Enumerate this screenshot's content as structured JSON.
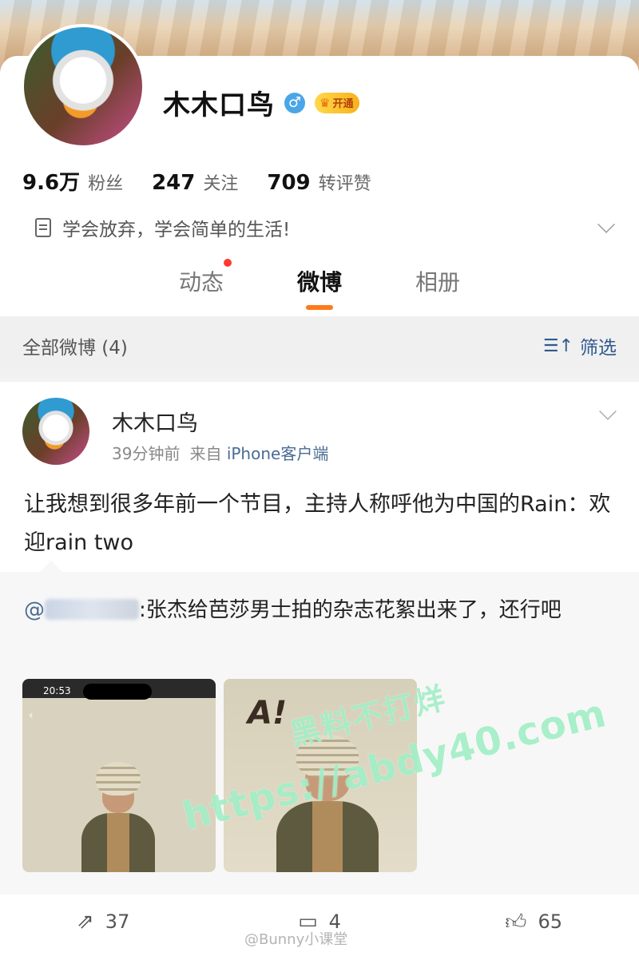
{
  "profile": {
    "name": "木木口鸟",
    "gender_icon": "♂",
    "vip_label": "开通",
    "stats": [
      {
        "value": "9.6万",
        "label": "粉丝"
      },
      {
        "value": "247",
        "label": "关注"
      },
      {
        "value": "709",
        "label": "转评赞"
      }
    ],
    "bio": "学会放弃，学会简单的生活!"
  },
  "tabs": [
    {
      "label": "动态",
      "has_dot": true
    },
    {
      "label": "微博",
      "active": true
    },
    {
      "label": "相册"
    }
  ],
  "filter_bar": {
    "count_label": "全部微博 (4)",
    "filter_label": "筛选"
  },
  "post": {
    "author": "木木口鸟",
    "time": "39分钟前",
    "source_prefix": "来自",
    "source": "iPhone客户端",
    "text": "让我想到很多年前一个节目，主持人称呼他为中国的Rain：欢迎rain two",
    "repost": {
      "mention_prefix": "@",
      "text": ":张杰给芭莎男士拍的杂志花絮出来了，还行吧",
      "image1_time": "20:53",
      "image2_scribble": "A!"
    },
    "actions": {
      "repost_count": "37",
      "comment_count": "4",
      "like_count": "65"
    }
  },
  "watermarks": {
    "cn": "黑料不打烊",
    "url": "https://abdy40.com",
    "weibo": "@Bunny小课堂"
  },
  "colors": {
    "accent": "#ff7a1a",
    "link": "#4a6b93",
    "watermark": "#96ebbe"
  }
}
